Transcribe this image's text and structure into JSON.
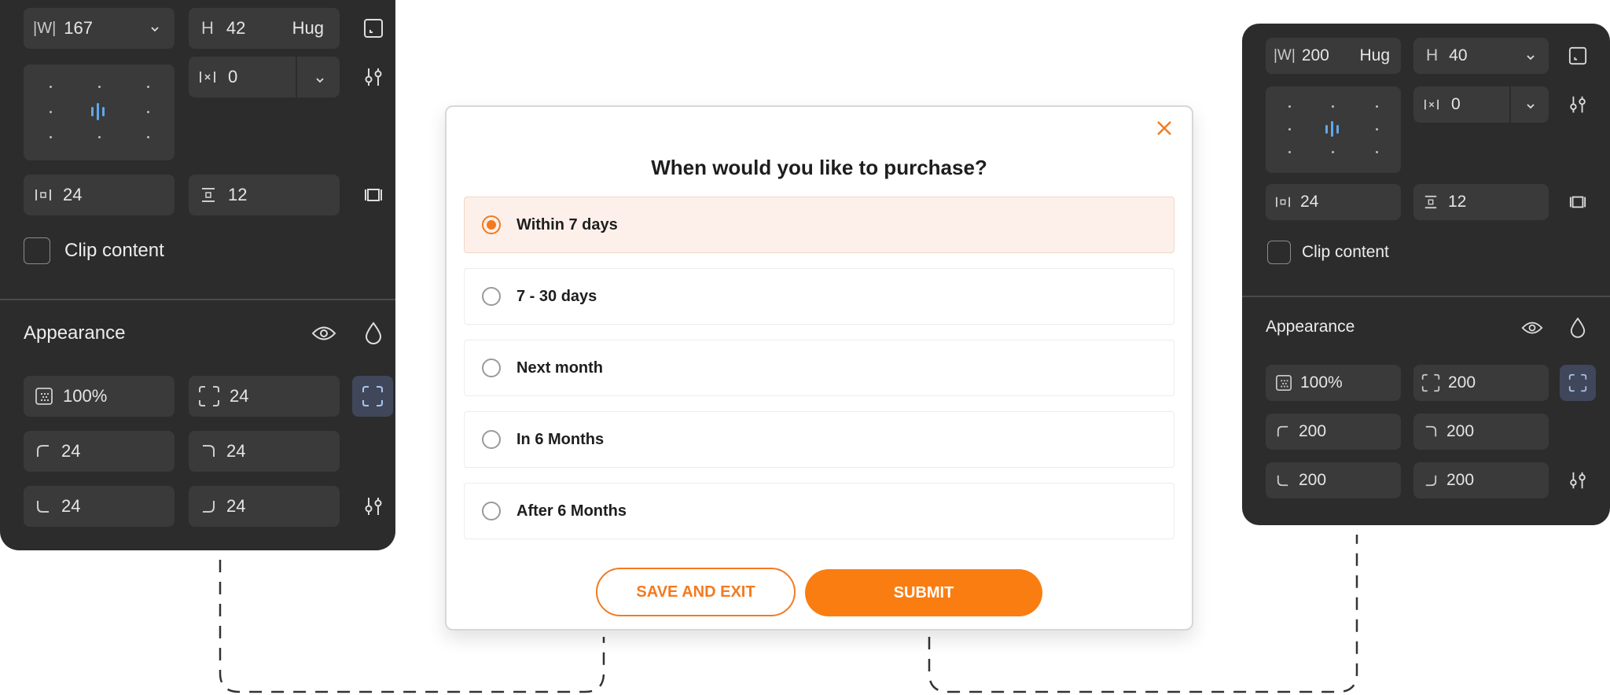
{
  "left_panel": {
    "width_prefix": "|W|",
    "width_value": "167",
    "height_prefix": "H",
    "height_value": "42",
    "height_mode": "Hug",
    "gap_value": "0",
    "pad_h": "24",
    "pad_v": "12",
    "clip_label": "Clip content",
    "appearance_title": "Appearance",
    "opacity": "100%",
    "radius_all": "24",
    "radius_tl": "24",
    "radius_tr": "24",
    "radius_bl": "24",
    "radius_br": "24"
  },
  "modal": {
    "question": "When would you like to purchase?",
    "options": [
      "Within 7 days",
      "7 - 30 days",
      "Next month",
      "In 6 Months",
      "After 6 Months"
    ],
    "selected_index": 0,
    "save_label": "SAVE AND EXIT",
    "submit_label": "SUBMIT",
    "accent_color": "#fa7d12"
  },
  "right_panel": {
    "width_prefix": "|W|",
    "width_value": "200",
    "width_mode": "Hug",
    "height_prefix": "H",
    "height_value": "40",
    "gap_value": "0",
    "pad_h": "24",
    "pad_v": "12",
    "clip_label": "Clip content",
    "appearance_title": "Appearance",
    "opacity": "100%",
    "radius_all": "200",
    "radius_tl": "200",
    "radius_tr": "200",
    "radius_bl": "200",
    "radius_br": "200"
  }
}
